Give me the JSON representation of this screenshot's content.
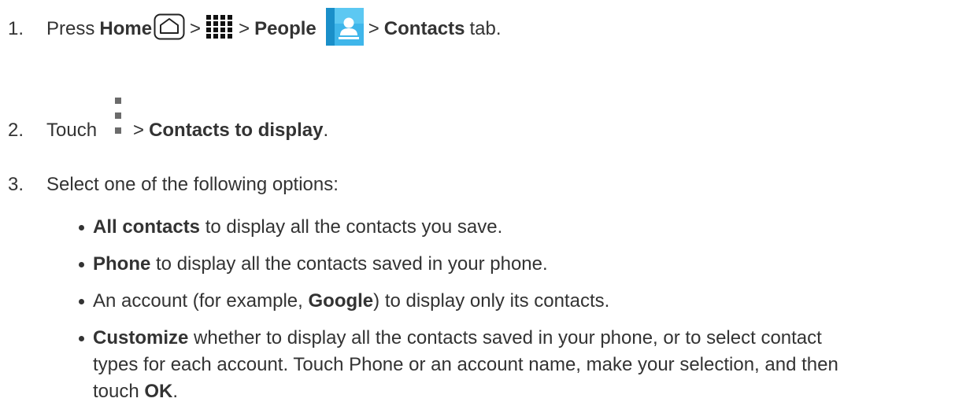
{
  "steps": [
    {
      "number": "1.",
      "parts": {
        "press": "Press",
        "home": "Home",
        "sep1": ">",
        "sep2": ">",
        "people": "People",
        "sep3": ">",
        "contacts": "Contacts",
        "tab": "tab."
      },
      "icons": [
        "home-key-icon",
        "apps-grid-icon",
        "people-app-icon"
      ]
    },
    {
      "number": "2.",
      "parts": {
        "touch": "Touch",
        "sep": ">",
        "option": "Contacts to display",
        "period": "."
      },
      "icons": [
        "menu-dots-icon"
      ]
    },
    {
      "number": "3.",
      "text": "Select one of the following options:"
    }
  ],
  "options": [
    {
      "bold": "All contacts",
      "rest": "to display all the contacts you save."
    },
    {
      "bold": "Phone",
      "rest": "to display all the contacts saved in your phone."
    },
    {
      "pre": "An account (for example,",
      "bold": "Google",
      "rest": ") to display only its contacts."
    },
    {
      "bold": "Customize",
      "rest_line1": "whether to display all the contacts saved in your phone, or to select contact",
      "rest_line2": "types for each account. Touch Phone or an account name, make your selection, and then",
      "rest_line3_pre": "touch",
      "rest_line3_bold": "OK",
      "rest_line3_post": "."
    }
  ],
  "colors": {
    "text": "#333333",
    "people_icon_light": "#4cc3f0",
    "people_icon_dark": "#1a8fc9"
  }
}
